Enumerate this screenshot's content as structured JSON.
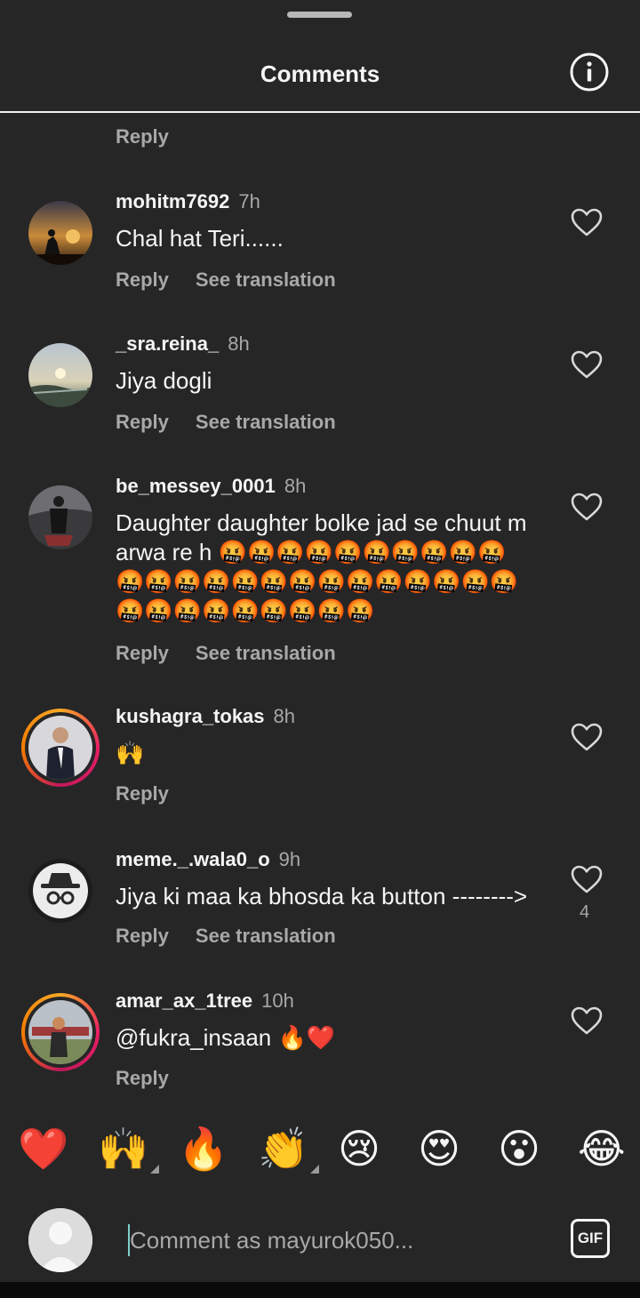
{
  "header": {
    "title": "Comments",
    "info_icon": "info-icon"
  },
  "top_reply_label": "Reply",
  "comments": [
    {
      "username": "mohitm7692",
      "time": "7h",
      "text": "Chal hat Teri......",
      "reply": "Reply",
      "translate": "See translation",
      "likes": ""
    },
    {
      "username": "_sra.reina_",
      "time": "8h",
      "text": "Jiya dogli",
      "reply": "Reply",
      "translate": "See translation",
      "likes": ""
    },
    {
      "username": "be_messey_0001",
      "time": "8h",
      "text": "Daughter daughter bolke jad se chuut marwa re h 🤬🤬🤬🤬🤬🤬🤬🤬🤬🤬🤬🤬🤬🤬🤬🤬🤬🤬🤬🤬🤬🤬🤬🤬🤬🤬🤬🤬🤬🤬🤬🤬🤬",
      "reply": "Reply",
      "translate": "See translation",
      "likes": ""
    },
    {
      "username": "kushagra_tokas",
      "time": "8h",
      "text": "🙌",
      "reply": "Reply",
      "translate": "",
      "likes": ""
    },
    {
      "username": "meme._.wala0_o",
      "time": "9h",
      "text": "Jiya ki maa ka bhosda ka button -------->",
      "reply": "Reply",
      "translate": "See translation",
      "likes": "4"
    },
    {
      "username": "amar_ax_1tree",
      "time": "10h",
      "text": "@fukra_insaan 🔥❤️",
      "reply": "Reply",
      "translate": "",
      "likes": ""
    }
  ],
  "emoji_bar": [
    "❤️",
    "🙌",
    "🔥",
    "👏",
    "😢",
    "😍",
    "😮",
    "😂"
  ],
  "composer": {
    "placeholder": "Comment as mayurok050...",
    "gif_label": "GIF"
  },
  "colors": {
    "background": "#262626",
    "secondary_text": "#a8a8a8",
    "primary_text": "#f5f5f5"
  }
}
